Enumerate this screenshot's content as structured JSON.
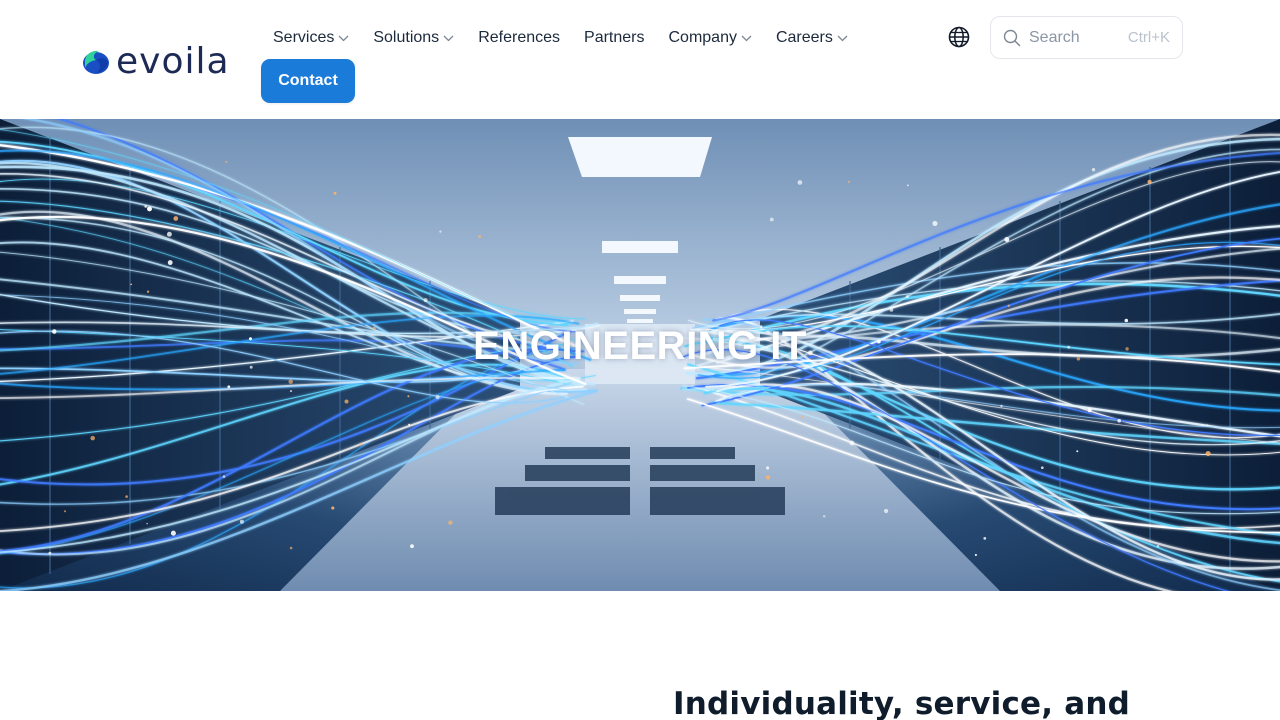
{
  "brand": {
    "name": "evoila",
    "logo_colors": {
      "primary": "#1a4fc4",
      "accent": "#2fd29a",
      "text": "#1d2a55"
    }
  },
  "nav": {
    "items": [
      {
        "label": "Services",
        "has_dropdown": true
      },
      {
        "label": "Solutions",
        "has_dropdown": true
      },
      {
        "label": "References",
        "has_dropdown": false
      },
      {
        "label": "Partners",
        "has_dropdown": false
      },
      {
        "label": "Company",
        "has_dropdown": true
      },
      {
        "label": "Careers",
        "has_dropdown": true
      }
    ],
    "contact_label": "Contact",
    "contact_color": "#1a7bd9",
    "language_icon": "globe-icon"
  },
  "search": {
    "placeholder": "Search",
    "value": "",
    "shortcut": "Ctrl+K",
    "icon": "search-icon"
  },
  "hero": {
    "title": "ENGINEERING IT",
    "background": "data-center-corridor-with-light-streaks"
  },
  "intro": {
    "heading": "Individuality, service, and"
  }
}
